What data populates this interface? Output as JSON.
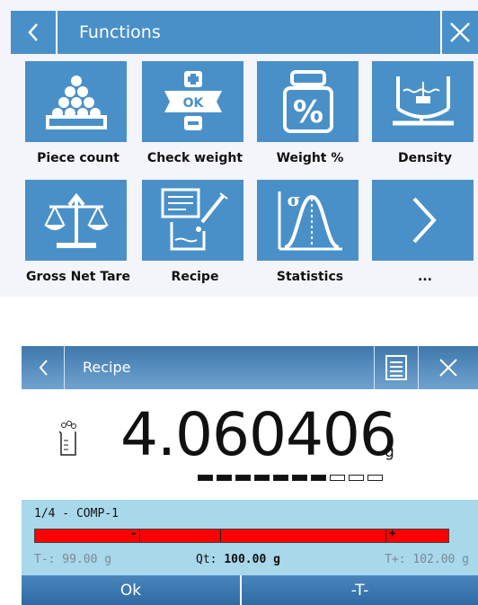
{
  "functions": {
    "title": "Functions",
    "header_color": "#4a90c8",
    "items": [
      {
        "label": "Piece count",
        "icon": "piece-count-icon"
      },
      {
        "label": "Check weight",
        "icon": "check-weight-icon",
        "icon_text": "OK"
      },
      {
        "label": "Weight %",
        "icon": "weight-percent-icon",
        "icon_text": "%"
      },
      {
        "label": "Density",
        "icon": "density-icon"
      },
      {
        "label": "Gross Net Tare",
        "icon": "gross-net-tare-icon"
      },
      {
        "label": "Recipe",
        "icon": "recipe-icon"
      },
      {
        "label": "Statistics",
        "icon": "statistics-icon",
        "icon_text": "σ"
      },
      {
        "label": "...",
        "icon": "next-arrow-icon"
      }
    ]
  },
  "recipe": {
    "title": "Recipe",
    "weight": "4.060406",
    "unit": "g",
    "segments_total": 10,
    "segments_filled": 7,
    "component": "1/4 - COMP-1",
    "bar_color": "#ff0000",
    "tolerance_minus": "T-: 99.00 g",
    "qt_label": "Qt:",
    "qt_value": "100.00 g",
    "tolerance_plus": "T+: 102.00 g",
    "ok_label": "Ok",
    "tare_label": "-T-"
  }
}
